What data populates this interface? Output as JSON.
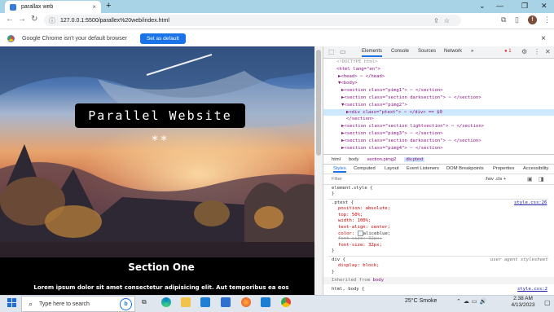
{
  "browser": {
    "tab_title": "parallax web",
    "tab_close": "×",
    "new_tab": "+",
    "url": "127.0.0.1:5500/parallex%20web/index.html",
    "avatar_letter": "f",
    "win_minimize": "⌄",
    "win_min": "—",
    "win_restore": "❐",
    "win_close": "✕"
  },
  "infobar": {
    "message": "Google Chrome isn't your default browser",
    "button": "Set as default",
    "close": "×"
  },
  "page": {
    "hero_text": "Parallel Website **",
    "section_title": "Section One",
    "section_body": "Lorem ipsum dolor sit amet consectetur adipisicing elit. Aut temporibus ea eos"
  },
  "devtools": {
    "tabs": [
      "Elements",
      "Console",
      "Sources",
      "Network"
    ],
    "more": "»",
    "badge": "1",
    "dom": {
      "l0": "<!DOCTYPE html>",
      "l1": "<html lang=\"en\">",
      "l2": "▶<head> ⋯ </head>",
      "l3": "▼<body>",
      "l4": "▶<section class=\"pimg1\"> ⋯ </section>",
      "l5": "▶<section class=\"section darksection\"> ⋯ </section>",
      "l6": "▼<section class=\"pimg2\">",
      "l7": "▶<div class=\"ptext\"> ⋯ </div> == $0",
      "l8": "</section>",
      "l9": "▶<section class=\"section lightsection\"> ⋯ </section>",
      "l10": "▶<section class=\"pimg3\"> ⋯ </section>",
      "l11": "▶<section class=\"section darksection\"> ⋯ </section>",
      "l12": "▶<section class=\"pimg4\"> ⋯ </section>"
    },
    "breadcrumbs": [
      "html",
      "body",
      "section.pimg2",
      "div.ptext"
    ],
    "style_tabs": [
      "Styles",
      "Computed",
      "Layout",
      "Event Listeners",
      "DOM Breakpoints",
      "Properties",
      "Accessibility"
    ],
    "filter_placeholder": "Filter",
    "filter_controls": ":hov  .cls  +",
    "rules": {
      "element_style": "element.style {",
      "close": "}",
      "ptext_selector": ".ptext {",
      "ptext_source": "style.css:26",
      "p1": "position: absolute;",
      "p2": "top: 50%;",
      "p3": "width: 100%;",
      "p4": "text-align: center;",
      "p5": "color: ",
      "p5v": "aliceblue;",
      "p6": "font-size: 32px;",
      "p7": "font-size: 32px;",
      "div_selector": "div {",
      "div_source": "user agent stylesheet",
      "div_p1": "display: block;",
      "inherited": "Inherited from ",
      "inherited_el": "body",
      "last_selector": "html, body {",
      "last_source": "style.css:2"
    }
  },
  "taskbar": {
    "search_text": "Type here to search",
    "weather": "25°C  Smoke",
    "time": "2:38 AM",
    "date": "4/13/2023"
  }
}
